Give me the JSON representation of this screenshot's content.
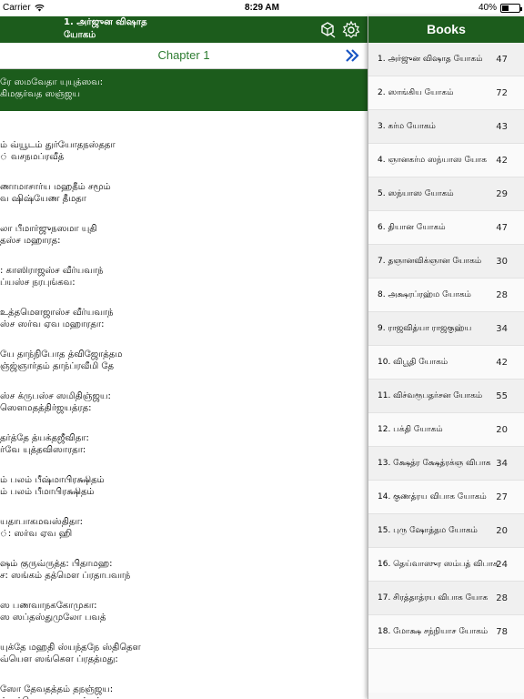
{
  "status_bar": {
    "carrier": "Carrier",
    "time": "8:29 AM",
    "battery": "40%",
    "battery_level": 0.4
  },
  "reader": {
    "title": "1. அர்ஜுன விஷாத\nயோகம்",
    "chapter_label": "Chapter 1",
    "highlighted_verse": "ரே ஸமவேதா யுயுத்ஸவ:\nகிமகுர்வத ஸஞ்ஜய",
    "verses": [
      "ம் வ்யூடம் துர்யோதநஸ்ததா\n் வசநமப்ரவீத்",
      "ணாமாசார்ய மஹதீம் சமூம்\nவ ஷிஷ்யேண தீமதா",
      "லா பீமார்ஜுநஸமா யுதி\nதஸ்ச மஹாரத:",
      ": காஸிராஜஸ்ச வீர்யவாந்\nப்யஸ்ச நரபுங்கவ:",
      "உத்தமௌஜாஸ்ச வீர்யவாந்\nஸ்ச ஸர்வ ஏவ மஹாரதா:",
      "யே தாந்நிபோத த்விஜோத்தம\nஞ்ஜ்ஞார்தம் தாந்ப்ரவீமி தே",
      "ஸ்ச க்ருபஸ்ச ஸமிதிஞ்ஜய:\nஸௌமதத்திர்ஜயத்ரத:",
      "தர்த்தே த்யக்தஜீவிதா:\nர்வே யுத்தவிஸாரதா:",
      "ம் பலம் பீஷ்மாபிரக்ஷிதம்\nம் பலம் பீமாபிரக்ஷிதம்",
      "யதாபாகமவஸ்திதா:\n்: ஸர்வ ஏவ ஹி",
      "ஷம் குருவ்ருத்த: பிதாமஹ:\nச: ஸங்கம் தத்மௌ ப்ரதாபவாந்",
      "ஸ பணவாநககோமுகா:\nஸ ஸப்தஸ்துமுலோ பவத்",
      "யுக்தே மஹதி ஸ்யந்தநே ஸ்திதௌ\nவ்யௌ ஸங்கௌ ப்ரதத்மது:",
      "ஸோ தேவதத்தம் தநஞ்ஜய:\nம் தத்மௌ மஹாஸங்கம்"
    ],
    "icons": {
      "share": "share-icon",
      "settings": "gear-icon",
      "next": "double-chevron-right-icon"
    }
  },
  "books_panel": {
    "title": "Books",
    "items": [
      {
        "name": "1. அர்ஜுன விஷாத யோகம்",
        "count": "47"
      },
      {
        "name": "2. ஸாங்கிய யோகம்",
        "count": "72"
      },
      {
        "name": "3. கர்ம யோகம்",
        "count": "43"
      },
      {
        "name": "4. ஞானகர்ம ஸந்யாஸ யோக",
        "count": "42"
      },
      {
        "name": "5. ஸந்யாஸ யோகம்",
        "count": "29"
      },
      {
        "name": "6. தியான யோகம்",
        "count": "47"
      },
      {
        "name": "7. தஞானவிக்ஞான யோகம்",
        "count": "30"
      },
      {
        "name": "8. அக்ஷரப்ரஹ்ம யோகம்",
        "count": "28"
      },
      {
        "name": "9. ராஜவித்யா ராஜகுஹ்ய",
        "count": "34"
      },
      {
        "name": "10. விபூதி யோகம்",
        "count": "42"
      },
      {
        "name": "11. விச்வரூபதர்சன யோகம்",
        "count": "55"
      },
      {
        "name": "12. பக்தி யோகம்",
        "count": "20"
      },
      {
        "name": "13. க்ஷேத்ர க்ஷேத்ரக்ஞ விபாக",
        "count": "34"
      },
      {
        "name": "14. குணத்ரய விபாக யோகம்",
        "count": "27"
      },
      {
        "name": "15. புரு ஷோத்தம யோகம்",
        "count": "20"
      },
      {
        "name": "16. தெய்வாஸுர ஸம்பத் விபாக",
        "count": "24"
      },
      {
        "name": "17. சிரத்தாத்ரய விபாக யோக",
        "count": "28"
      },
      {
        "name": "18. மோக்ஷ சந்நியாச யோகம்",
        "count": "78"
      }
    ]
  },
  "colors": {
    "header_green": "#1c5c1c",
    "chapter_green": "#2e7d32",
    "accent_blue": "#1a56c4"
  }
}
